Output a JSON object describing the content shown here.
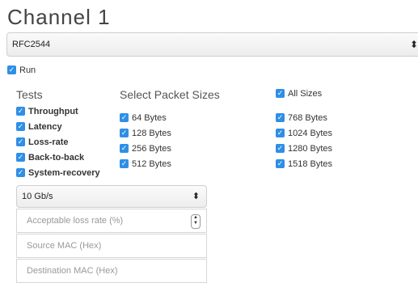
{
  "title": "Channel 1",
  "protocol_select": {
    "value": "RFC2544",
    "arrows": "⬍"
  },
  "run": {
    "label": "Run",
    "checked": true
  },
  "tests": {
    "heading": "Tests",
    "items": [
      {
        "label": "Throughput",
        "checked": true
      },
      {
        "label": "Latency",
        "checked": true
      },
      {
        "label": "Loss-rate",
        "checked": true
      },
      {
        "label": "Back-to-back",
        "checked": true
      },
      {
        "label": "System-recovery",
        "checked": true
      }
    ]
  },
  "packet_sizes": {
    "heading": "Select Packet Sizes",
    "all_sizes": {
      "label": "All Sizes",
      "checked": true
    },
    "left_column": [
      {
        "label": "64 Bytes",
        "checked": true
      },
      {
        "label": "128 Bytes",
        "checked": true
      },
      {
        "label": "256 Bytes",
        "checked": true
      },
      {
        "label": "512 Bytes",
        "checked": true
      }
    ],
    "right_column": [
      {
        "label": "768 Bytes",
        "checked": true
      },
      {
        "label": "1024 Bytes",
        "checked": true
      },
      {
        "label": "1280 Bytes",
        "checked": true
      },
      {
        "label": "1518 Bytes",
        "checked": true
      }
    ]
  },
  "speed_select": {
    "value": "10 Gb/s",
    "arrows": "⬍"
  },
  "fields": {
    "loss_rate_placeholder": "Acceptable loss rate (%)",
    "source_mac_placeholder": "Source MAC (Hex)",
    "destination_mac_placeholder": "Destination MAC (Hex)"
  },
  "colors": {
    "checkbox": "#2f8fe5",
    "text": "#333333",
    "placeholder": "#999999"
  },
  "icons": {
    "checkbox": "checkmark-icon",
    "select_arrows": "updown-arrows-icon"
  }
}
